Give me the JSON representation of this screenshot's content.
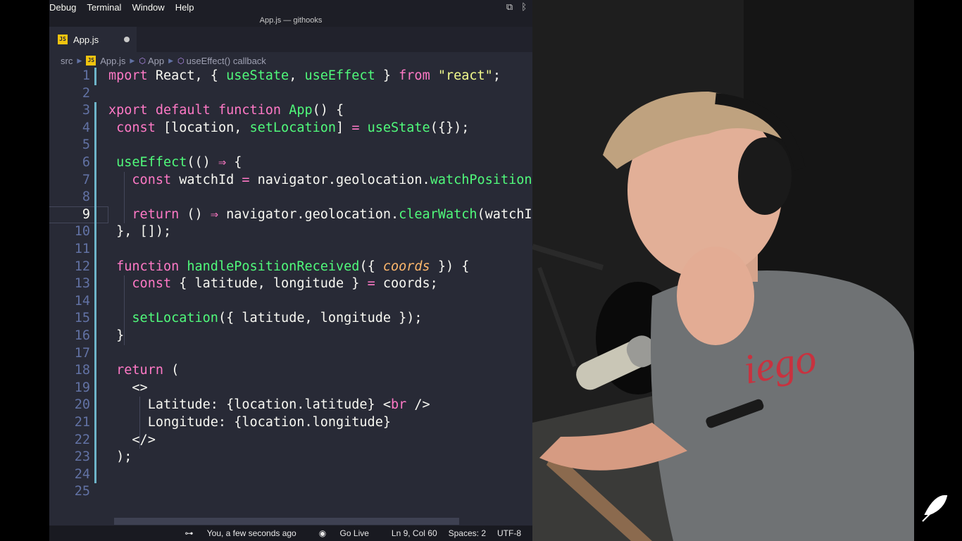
{
  "menu": [
    "Debug",
    "Terminal",
    "Window",
    "Help"
  ],
  "window_title": "App.js — githooks",
  "tab": {
    "label": "App.js",
    "icon": "JS"
  },
  "breadcrumb": [
    "src",
    "App.js",
    "App",
    "useEffect() callback"
  ],
  "code_lines": [
    {
      "n": "1",
      "t": "mport React, { useState, useEffect } from \"react\";"
    },
    {
      "n": "2",
      "t": ""
    },
    {
      "n": "3",
      "t": "xport default function App() {"
    },
    {
      "n": "4",
      "t": " const [location, setLocation] = useState({});"
    },
    {
      "n": "5",
      "t": ""
    },
    {
      "n": "6",
      "t": " useEffect(() ⇒ {"
    },
    {
      "n": "7",
      "t": "   const watchId = navigator.geolocation.watchPosition("
    },
    {
      "n": "8",
      "t": ""
    },
    {
      "n": "9",
      "t": "   return () ⇒ navigator.geolocation.clearWatch(watchI"
    },
    {
      "n": "10",
      "t": " }, []);"
    },
    {
      "n": "11",
      "t": ""
    },
    {
      "n": "12",
      "t": " function handlePositionReceived({ coords }) {"
    },
    {
      "n": "13",
      "t": "   const { latitude, longitude } = coords;"
    },
    {
      "n": "14",
      "t": ""
    },
    {
      "n": "15",
      "t": "   setLocation({ latitude, longitude });"
    },
    {
      "n": "16",
      "t": " }"
    },
    {
      "n": "17",
      "t": ""
    },
    {
      "n": "18",
      "t": " return ("
    },
    {
      "n": "19",
      "t": "   <>"
    },
    {
      "n": "20",
      "t": "     Latitude: {location.latitude} <br />"
    },
    {
      "n": "21",
      "t": "     Longitude: {location.longitude}"
    },
    {
      "n": "22",
      "t": "   </>"
    },
    {
      "n": "23",
      "t": " );"
    },
    {
      "n": "24",
      "t": ""
    },
    {
      "n": "25",
      "t": ""
    }
  ],
  "status": {
    "git_blame": "You, a few seconds ago",
    "live": "Go Live",
    "position": "Ln 9, Col 60",
    "spaces": "Spaces: 2",
    "encoding": "UTF-8"
  },
  "icons": [
    "js-file-icon",
    "chevron-right-icon",
    "cube-icon",
    "git-commit-icon",
    "broadcast-icon",
    "screen-record-icon",
    "bluetooth-icon",
    "feather-logo-icon"
  ],
  "colors": {
    "editor_bg": "#282a36",
    "keyword": "#ff79c6",
    "function": "#50fa7b",
    "string": "#f1fa8c",
    "param": "#ffb86c"
  }
}
